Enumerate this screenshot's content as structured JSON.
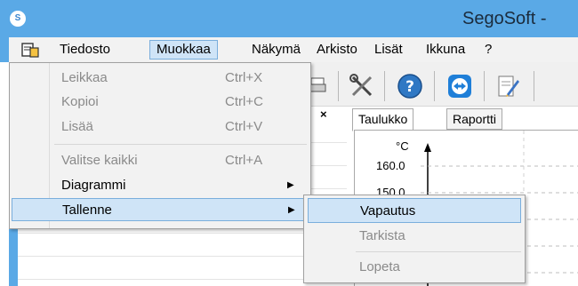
{
  "window": {
    "title": "SegoSoft -",
    "logo_text": "S"
  },
  "menubar": {
    "items": [
      "Tiedosto",
      "Muokkaa",
      "Näkymä",
      "Arkisto",
      "Lisät",
      "Ikkuna",
      "?"
    ],
    "open_item": "Muokkaa"
  },
  "dropdown": {
    "items": [
      {
        "label": "Leikkaa",
        "shortcut": "Ctrl+X",
        "enabled": false,
        "submenu": false
      },
      {
        "label": "Kopioi",
        "shortcut": "Ctrl+C",
        "enabled": false,
        "submenu": false
      },
      {
        "label": "Lisää",
        "shortcut": "Ctrl+V",
        "enabled": false,
        "submenu": false
      },
      {
        "label": "Valitse kaikki",
        "shortcut": "Ctrl+A",
        "enabled": false,
        "submenu": false
      },
      {
        "label": "Diagrammi",
        "shortcut": "",
        "enabled": true,
        "submenu": true
      },
      {
        "label": "Tallenne",
        "shortcut": "",
        "enabled": true,
        "submenu": true,
        "highlighted": true
      }
    ]
  },
  "submenu": {
    "items": [
      {
        "label": "Vapautus",
        "enabled": true,
        "highlighted": true
      },
      {
        "label": "Tarkista",
        "enabled": false
      },
      {
        "label": "Lopeta",
        "enabled": false
      }
    ]
  },
  "left_pane": {
    "close_glyph": "×"
  },
  "tabs": {
    "items": [
      "Taulukko",
      "Raportti"
    ],
    "active": "Taulukko"
  },
  "chart": {
    "unit": "°C",
    "y_labels": [
      "160.0",
      "150.0"
    ]
  },
  "colors": {
    "accent": "#5aa9e6",
    "highlight_bg": "#cfe4f7",
    "highlight_border": "#7aaedc"
  }
}
